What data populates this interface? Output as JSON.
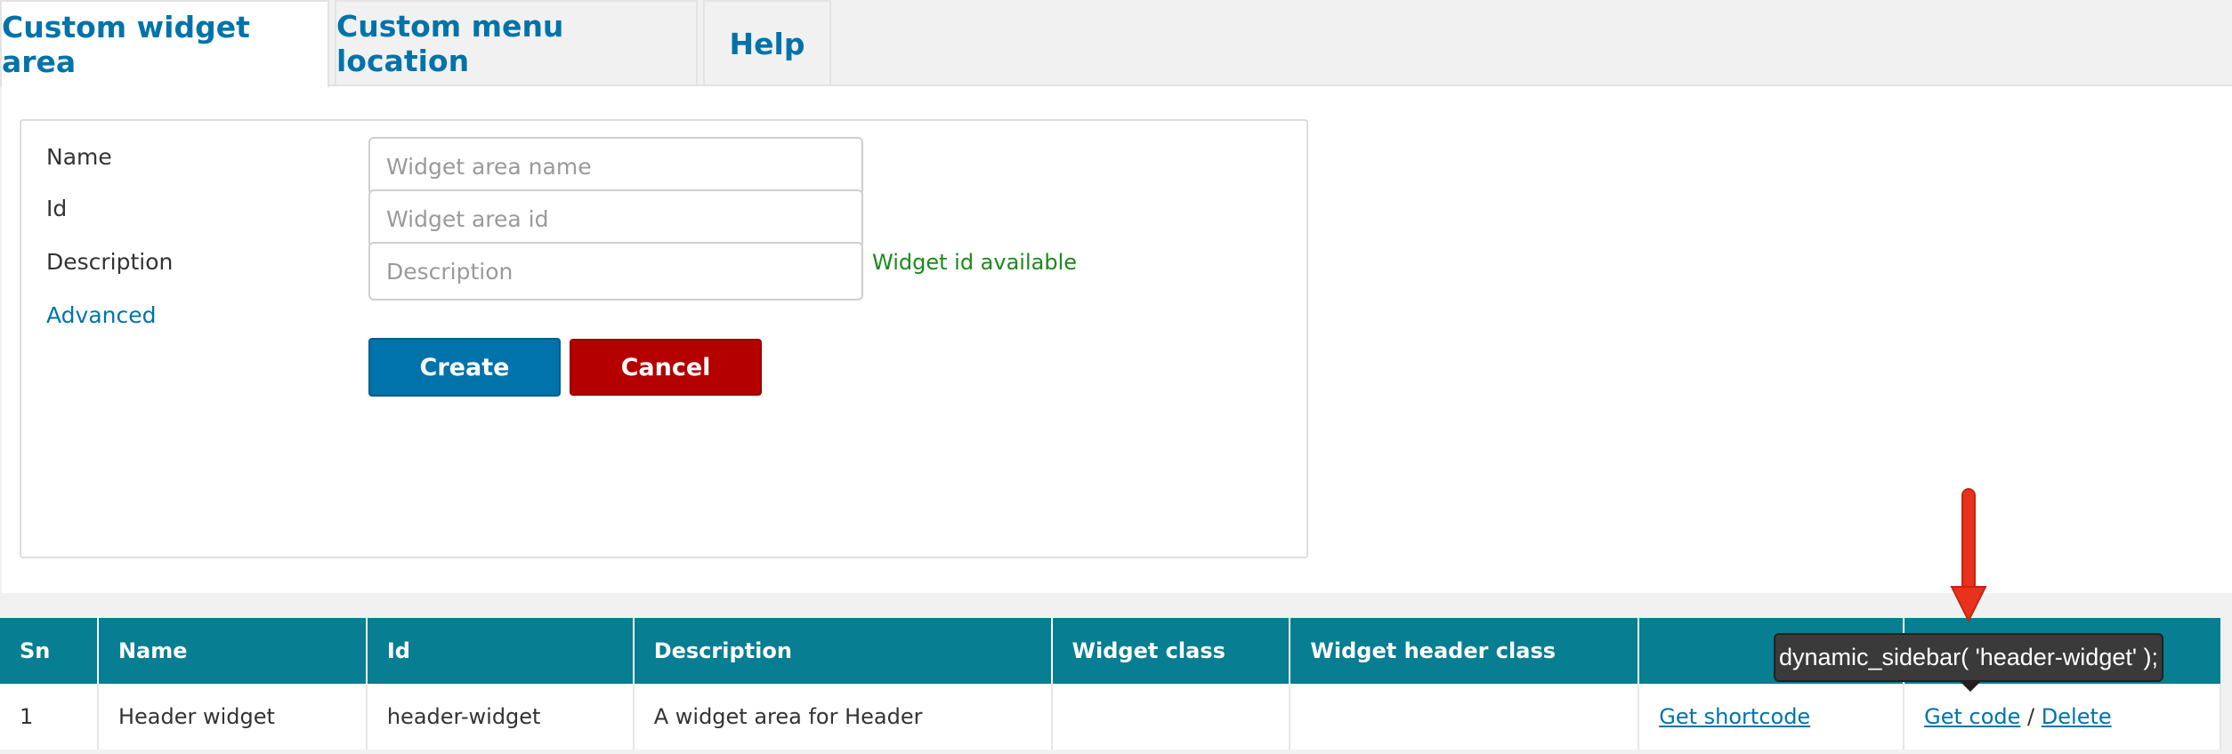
{
  "tabs": [
    {
      "label": "Custom widget area",
      "active": true
    },
    {
      "label": "Custom menu location",
      "active": false
    },
    {
      "label": "Help",
      "active": false
    }
  ],
  "form": {
    "name_label": "Name",
    "name_placeholder": "Widget area name",
    "id_label": "Id",
    "id_placeholder": "Widget area id",
    "id_status": "Widget id available",
    "description_label": "Description",
    "description_placeholder": "Description",
    "advanced_link": "Advanced",
    "create_button": "Create",
    "cancel_button": "Cancel"
  },
  "table": {
    "headers": [
      "Sn",
      "Name",
      "Id",
      "Description",
      "Widget class",
      "Widget header class",
      "",
      ""
    ],
    "rows": [
      {
        "sn": "1",
        "name": "Header widget",
        "id": "header-widget",
        "description": "A widget area for Header",
        "widget_class": "",
        "widget_header_class": "",
        "shortcode_link": "Get shortcode",
        "code_link": "Get code",
        "separator": "/",
        "delete_link": "Delete"
      }
    ]
  },
  "tooltip": {
    "text": "dynamic_sidebar( 'header-widget' );"
  },
  "colors": {
    "accent": "#0073aa",
    "table_header": "#077e92",
    "cancel": "#b50000",
    "available": "#1a8a1a",
    "annotation_arrow": "#e8321d"
  }
}
